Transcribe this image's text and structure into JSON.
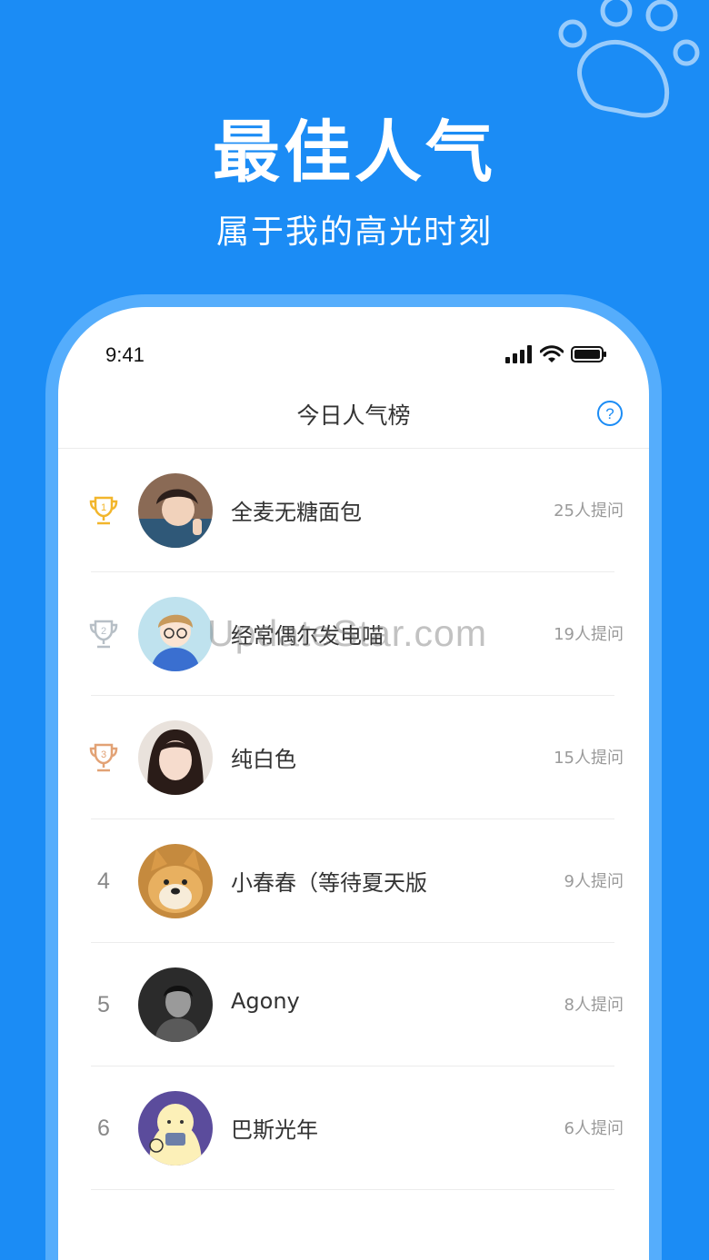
{
  "hero": {
    "title": "最佳人气",
    "subtitle": "属于我的高光时刻"
  },
  "status_bar": {
    "time": "9:41",
    "icons": [
      "signal-icon",
      "wifi-icon",
      "battery-icon"
    ]
  },
  "nav": {
    "title": "今日人气榜",
    "help_icon": "help-circle-icon"
  },
  "ranking": [
    {
      "rank": "1",
      "badge": "trophy-gold",
      "name": "全麦无糖面包",
      "count": "25人提问",
      "badge_color": "#f2b62c"
    },
    {
      "rank": "2",
      "badge": "trophy-silver",
      "name": "经常偶尔发电喵",
      "count": "19人提问",
      "badge_color": "#b7bfc6"
    },
    {
      "rank": "3",
      "badge": "trophy-bronze",
      "name": "纯白色",
      "count": "15人提问",
      "badge_color": "#e2a275"
    },
    {
      "rank": "4",
      "name": "小春春（等待夏天版",
      "count": "9人提问"
    },
    {
      "rank": "5",
      "name": "Agony",
      "count": "8人提问"
    },
    {
      "rank": "6",
      "name": "巴斯光年",
      "count": "6人提问"
    }
  ],
  "watermark": "UpdateStar.com",
  "colors": {
    "background": "#1b8cf5",
    "frame": "#55adfc",
    "help": "#1b8cf5"
  }
}
